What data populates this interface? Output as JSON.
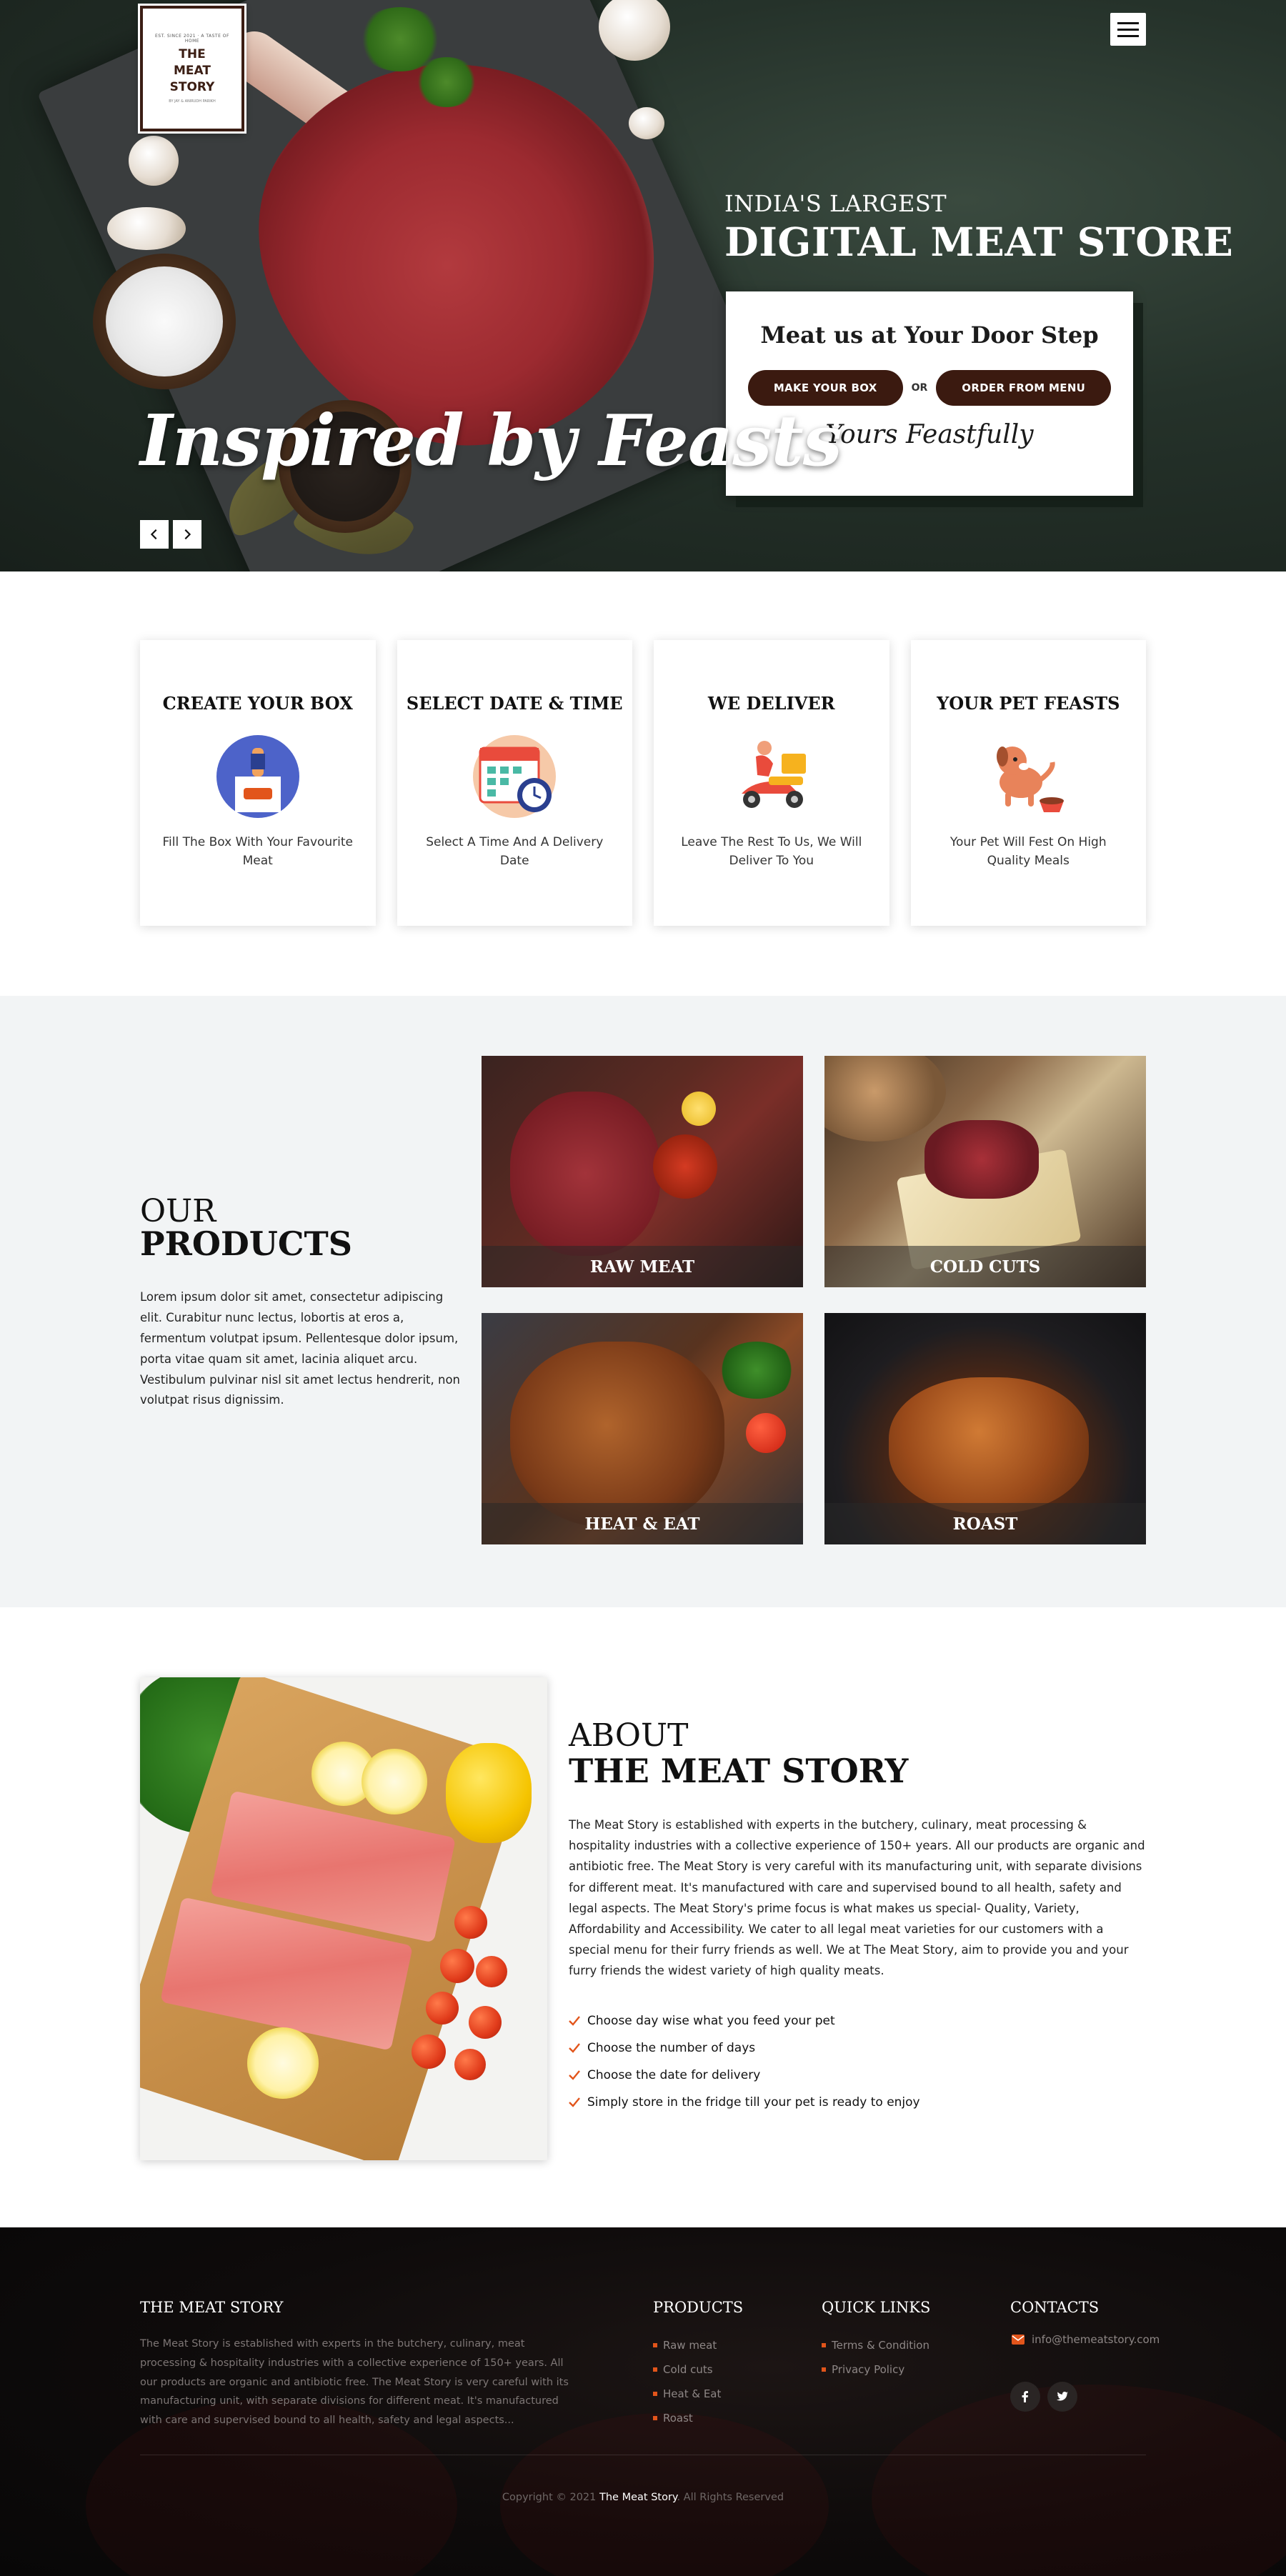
{
  "colors": {
    "brand_brown": "#3b1a10",
    "accent_orange": "#e2551b",
    "panel_gray": "#f2f4f5"
  },
  "logo": {
    "tagline": "EST. SINCE 2021 · A TASTE OF HOME",
    "name_line1": "THE",
    "name_line2": "MEAT",
    "name_line3": "STORY",
    "sub": "BY JAY & ANIRUDH PARIKH"
  },
  "header": {
    "menu_icon": "hamburger-icon"
  },
  "hero": {
    "kicker": "INDIA'S LARGEST",
    "title": "DIGITAL MEAT STORE",
    "script": "Inspired by Feasts",
    "card": {
      "heading": "Meat us at Your Door Step",
      "btn_box": "MAKE YOUR BOX",
      "or": "OR",
      "btn_menu": "ORDER FROM MENU",
      "signoff": "Yours Feastfully"
    },
    "prev_icon": "chevron-left-icon",
    "next_icon": "chevron-right-icon"
  },
  "steps": [
    {
      "title": "CREATE YOUR BOX",
      "text": "Fill The Box With Your Favourite Meat",
      "icon": "box-icon"
    },
    {
      "title": "SELECT DATE & TIME",
      "text": "Select A Time And A Delivery Date",
      "icon": "calendar-icon"
    },
    {
      "title": "WE DELIVER",
      "text": "Leave The Rest To Us, We Will Deliver To You",
      "icon": "delivery-scooter-icon"
    },
    {
      "title": "YOUR PET FEASTS",
      "text": "Your Pet Will Fest On High Quality Meals",
      "icon": "dog-icon"
    }
  ],
  "products": {
    "heading_line1": "OUR",
    "heading_line2": "PRODUCTS",
    "description": "Lorem ipsum dolor sit amet, consectetur adipiscing elit. Curabitur nunc lectus, lobortis at eros a, fermentum volutpat ipsum. Pellentesque dolor ipsum, porta vitae quam sit amet, lacinia aliquet arcu. Vestibulum pulvinar nisl sit amet lectus hendrerit, non volutpat risus dignissim.",
    "items": [
      "RAW MEAT",
      "COLD CUTS",
      "HEAT & EAT",
      "ROAST"
    ]
  },
  "about": {
    "heading_line1": "ABOUT",
    "heading_line2": "THE MEAT STORY",
    "text": "The Meat Story is established with experts in the butchery, culinary, meat processing & hospitality industries with a collective experience of 150+ years. All our products are organic and antibiotic free. The Meat Story is very careful with its manufacturing unit, with separate divisions for different meat. It's manufactured with care and supervised bound to all health, safety and legal aspects. The Meat Story's prime focus is what makes us special- Quality, Variety, Affordability and Accessibility. We cater to all legal meat varieties for our customers with a special menu for their furry friends as well. We at The Meat Story, aim to provide you and your furry friends the widest variety of high quality meats.",
    "checklist": [
      "Choose day wise what you feed your pet",
      "Choose the number of days",
      "Choose the date for delivery",
      "Simply store in the fridge till your pet is ready to enjoy"
    ]
  },
  "footer": {
    "about_title": "THE MEAT STORY",
    "about_text": "The Meat Story is established with experts in the butchery, culinary, meat processing & hospitality industries with a collective experience of 150+ years. All our products are organic and antibiotic free. The Meat Story is very careful with its manufacturing unit, with separate divisions for different meat. It's manufactured with care and supervised bound to all health, safety and legal aspects...",
    "products_title": "PRODUCTS",
    "products": [
      "Raw meat",
      "Cold cuts",
      "Heat & Eat",
      "Roast"
    ],
    "links_title": "QUICK LINKS",
    "links": [
      "Terms & Condition",
      "Privacy Policy"
    ],
    "contacts_title": "CONTACTS",
    "email": "info@themeatstory.com",
    "social": [
      "facebook-icon",
      "twitter-icon"
    ],
    "copyright_pre": "Copyright © 2021",
    "copyright_brand": "The Meat Story",
    "copyright_post": ". All Rights Reserved"
  }
}
